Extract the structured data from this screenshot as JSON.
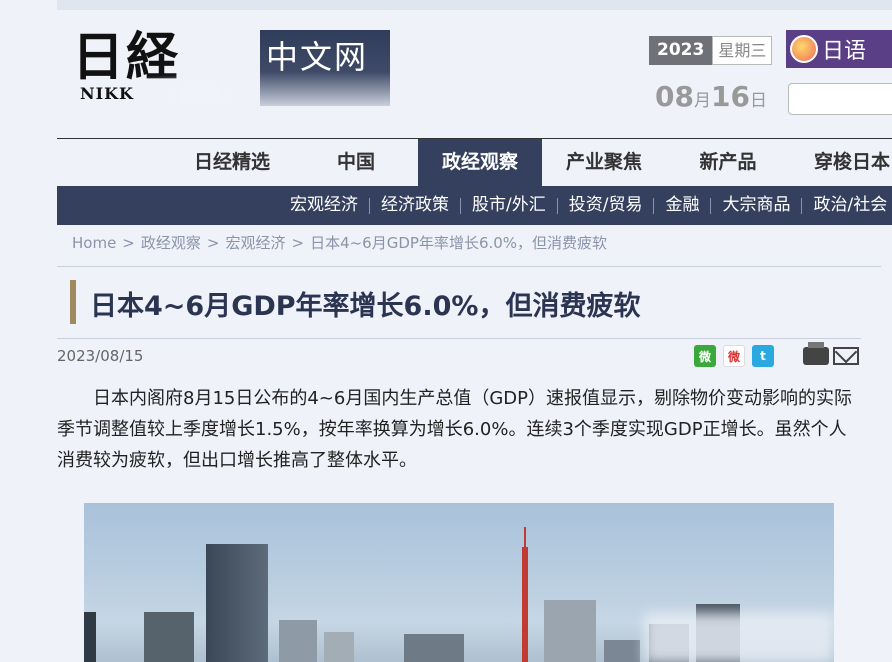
{
  "logo": {
    "kanji": "日経",
    "latin": "NIKK",
    "chinese": "中文网"
  },
  "date": {
    "year": "2023",
    "weekday": "星期三",
    "month": "08",
    "month_unit": "月",
    "day": "16",
    "day_unit": "日"
  },
  "promo": {
    "label": "日语 "
  },
  "search": {
    "placeholder": ""
  },
  "nav": {
    "items": [
      {
        "label": "日经精选"
      },
      {
        "label": "中国"
      },
      {
        "label": "政经观察",
        "active": true
      },
      {
        "label": "产业聚焦"
      },
      {
        "label": "新产品"
      },
      {
        "label": "穿梭日本"
      }
    ]
  },
  "subnav": {
    "items": [
      {
        "label": "宏观经济"
      },
      {
        "label": "经济政策"
      },
      {
        "label": "股市/外汇"
      },
      {
        "label": "投资/贸易"
      },
      {
        "label": "金融"
      },
      {
        "label": "大宗商品"
      },
      {
        "label": "政治/社会"
      }
    ]
  },
  "breadcrumb": {
    "items": [
      {
        "label": "Home"
      },
      {
        "label": "政经观察"
      },
      {
        "label": "宏观经济"
      },
      {
        "label": "日本4~6月GDP年率增长6.0%，但消费疲软"
      }
    ],
    "separator": ">"
  },
  "article": {
    "title": "日本4~6月GDP年率增长6.0%，但消费疲软",
    "date": "2023/08/15",
    "body": "日本内阁府8月15日公布的4~6月国内生产总值（GDP）速报值显示，剔除物价变动影响的实际季节调整值较上季度增长1.5%，按年率换算为增长6.0%。连续3个季度实现GDP正增长。虽然个人消费较为疲软，但出口增长推高了整体水平。"
  },
  "share": {
    "icons": [
      "wechat-icon",
      "weibo-icon",
      "twitter-icon"
    ],
    "wechat": "微",
    "weibo": "微",
    "twitter": "t",
    "tools": [
      "print-icon",
      "mail-icon"
    ]
  },
  "colors": {
    "nav_bg": "#34405d",
    "title": "#2b3552",
    "accent_bar": "#9e8a5c",
    "promo": "#5a3e86"
  }
}
